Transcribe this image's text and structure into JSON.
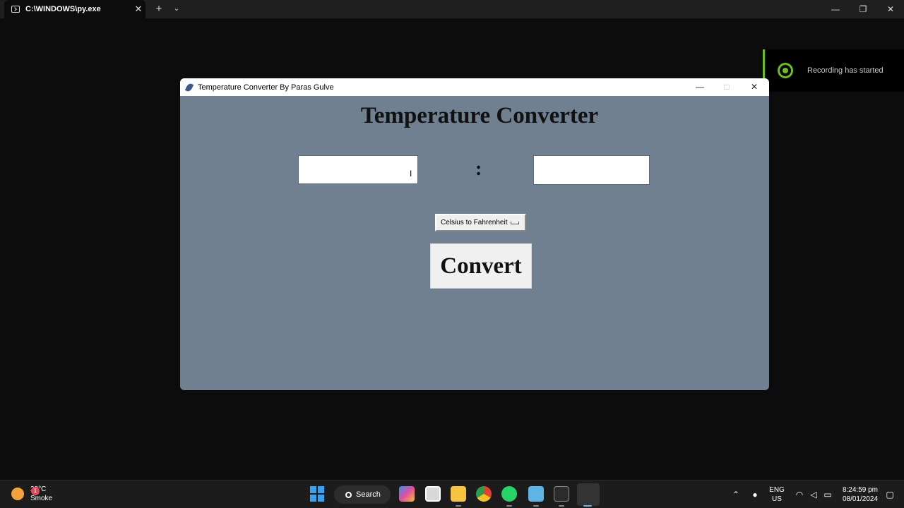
{
  "terminal": {
    "tab_title": "C:\\WINDOWS\\py.exe",
    "tab_close": "✕",
    "new_tab": "+",
    "dropdown": "⌄",
    "minimize": "—",
    "maximize": "❐",
    "close": "✕"
  },
  "notification": {
    "text": "Recording has started"
  },
  "app": {
    "window_title": "Temperature Converter By Paras Gulve",
    "minimize": "—",
    "maximize": "□",
    "close": "✕",
    "heading": "Temperature Converter",
    "input_value": "",
    "output_value": "",
    "separator": ":",
    "conversion_option": "Celsius to Fahrenheit",
    "convert_label": "Convert"
  },
  "taskbar": {
    "weather_badge": "1",
    "temperature": "28°C",
    "condition": "Smoke",
    "search_label": "Search",
    "lang_top": "ENG",
    "lang_bottom": "US",
    "time": "8:24:59 pm",
    "date": "08/01/2024",
    "icons": [
      "windows-start",
      "copilot",
      "task-view",
      "file-explorer",
      "chrome",
      "whatsapp",
      "notepad",
      "terminal",
      "python"
    ]
  }
}
